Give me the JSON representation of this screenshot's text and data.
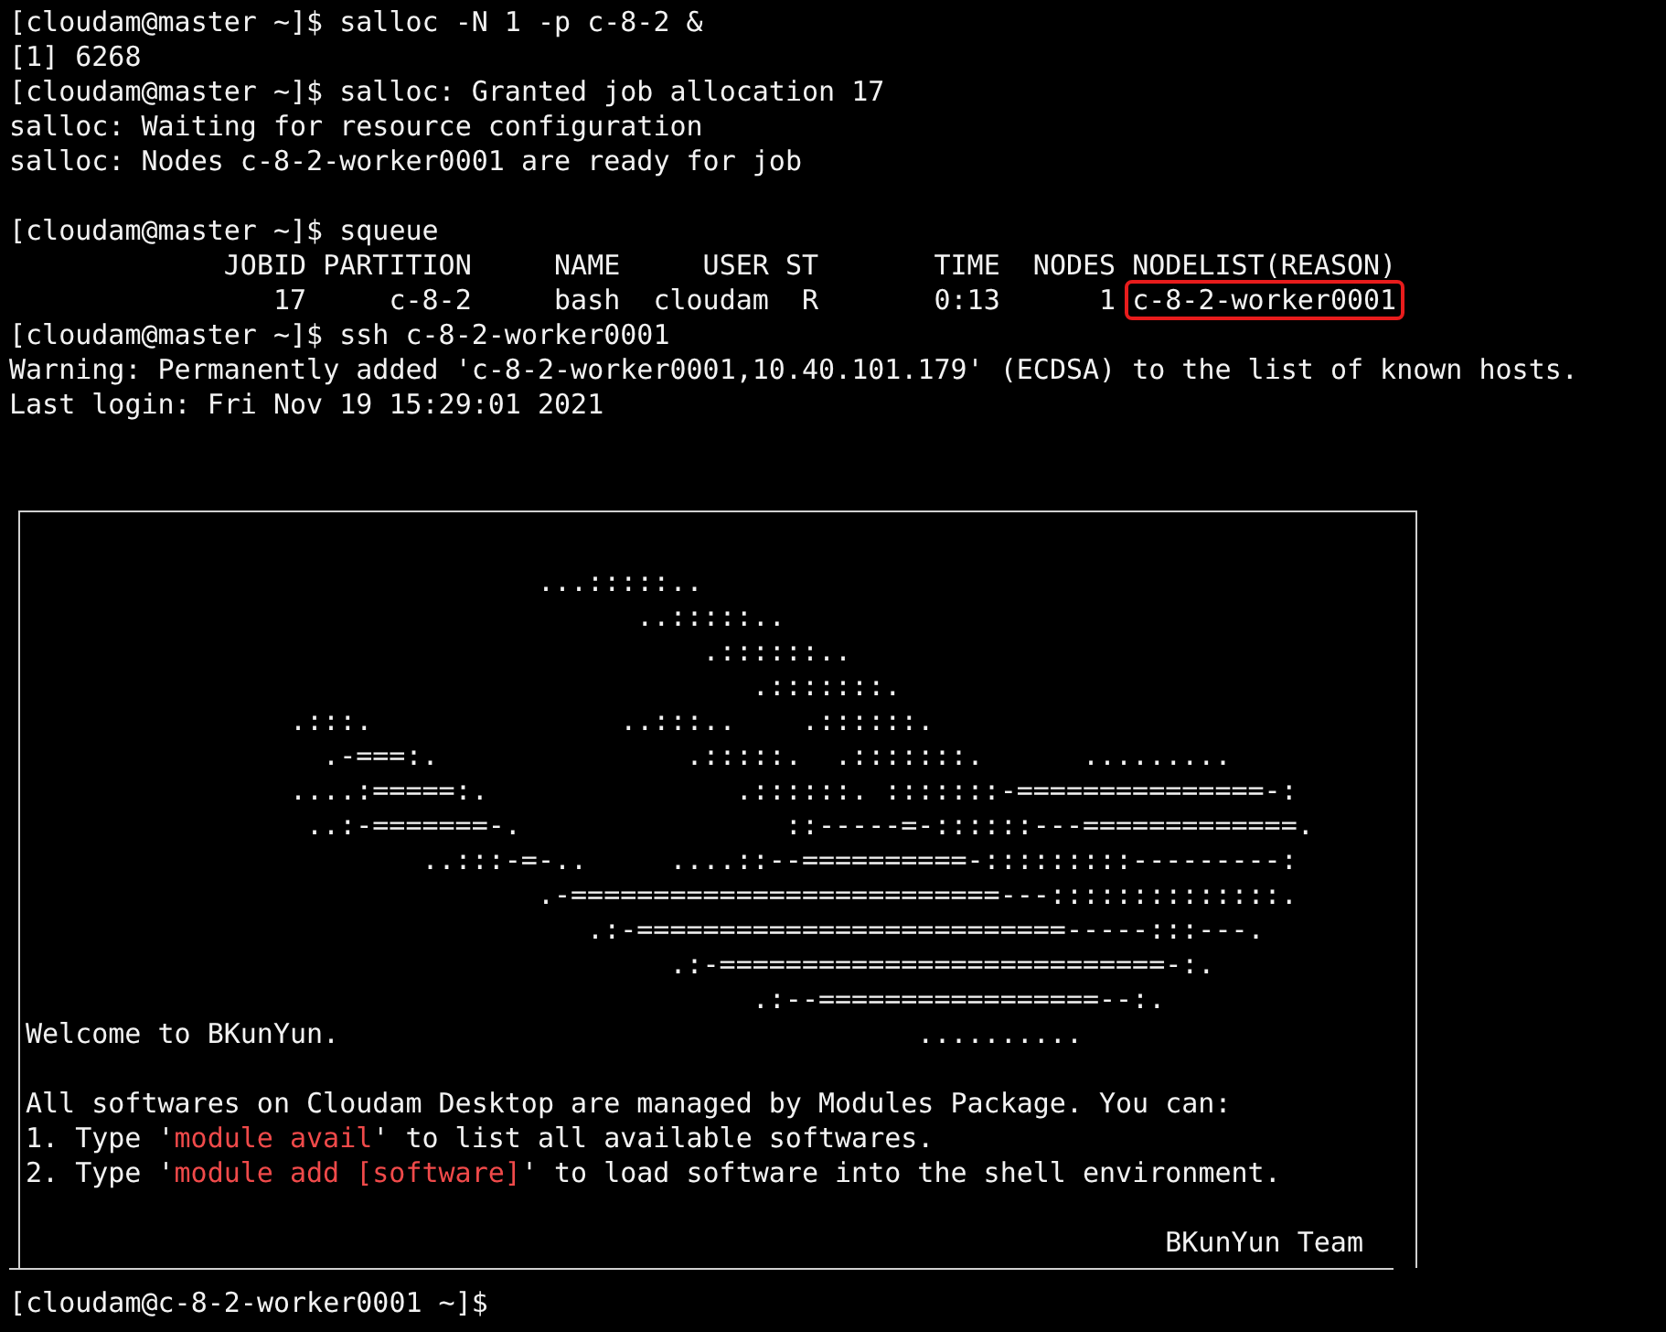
{
  "terminal": {
    "lines": [
      {
        "kind": "text",
        "segments": [
          {
            "kind": "plain",
            "text": "[cloudam@master ~]$ salloc -N 1 -p c-8-2 &"
          }
        ]
      },
      {
        "kind": "text",
        "segments": [
          {
            "kind": "plain",
            "text": "[1] 6268"
          }
        ]
      },
      {
        "kind": "text",
        "segments": [
          {
            "kind": "plain",
            "text": "[cloudam@master ~]$ salloc: Granted job allocation 17"
          }
        ]
      },
      {
        "kind": "text",
        "segments": [
          {
            "kind": "plain",
            "text": "salloc: Waiting for resource configuration"
          }
        ]
      },
      {
        "kind": "text",
        "segments": [
          {
            "kind": "plain",
            "text": "salloc: Nodes c-8-2-worker0001 are ready for job"
          }
        ]
      },
      {
        "kind": "blank"
      },
      {
        "kind": "text",
        "segments": [
          {
            "kind": "plain",
            "text": "[cloudam@master ~]$ squeue"
          }
        ]
      },
      {
        "kind": "text",
        "segments": [
          {
            "kind": "plain",
            "text": "             JOBID PARTITION     NAME     USER ST       TIME  NODES NODELIST(REASON)"
          }
        ]
      },
      {
        "kind": "text",
        "segments": [
          {
            "kind": "plain",
            "text": "                17     c-8-2     bash  cloudam  R       0:13      1 "
          },
          {
            "kind": "highlight",
            "text": "c-8-2-worker0001"
          }
        ]
      },
      {
        "kind": "text",
        "segments": [
          {
            "kind": "plain",
            "text": "[cloudam@master ~]$ ssh c-8-2-worker0001"
          }
        ]
      },
      {
        "kind": "text",
        "segments": [
          {
            "kind": "plain",
            "text": "Warning: Permanently added 'c-8-2-worker0001,10.40.101.179' (ECDSA) to the list of known hosts."
          }
        ]
      },
      {
        "kind": "text",
        "segments": [
          {
            "kind": "plain",
            "text": "Last login: Fri Nov 19 15:29:01 2021"
          }
        ]
      }
    ]
  },
  "motd": {
    "lines": [
      {
        "kind": "art",
        "segments": [
          {
            "kind": "plain",
            "text": "                               ...:::::.."
          }
        ]
      },
      {
        "kind": "art",
        "segments": [
          {
            "kind": "plain",
            "text": "                                     ..:::::.."
          }
        ]
      },
      {
        "kind": "art",
        "segments": [
          {
            "kind": "plain",
            "text": "                                         .::::::.."
          }
        ]
      },
      {
        "kind": "art",
        "segments": [
          {
            "kind": "plain",
            "text": "                                            .:::::::."
          }
        ]
      },
      {
        "kind": "art",
        "segments": [
          {
            "kind": "plain",
            "text": "                .:::.               ..:::..    .::::::."
          }
        ]
      },
      {
        "kind": "art",
        "segments": [
          {
            "kind": "plain",
            "text": "                  .-===:.               .:::::.  .:::::::.      ........."
          }
        ]
      },
      {
        "kind": "art",
        "segments": [
          {
            "kind": "plain",
            "text": "                ....:=====:.               .::::::. :::::::-===============-:"
          }
        ]
      },
      {
        "kind": "art",
        "segments": [
          {
            "kind": "plain",
            "text": "                 ..:-=======-.                ::-----=-::::::---=============."
          }
        ]
      },
      {
        "kind": "art",
        "segments": [
          {
            "kind": "plain",
            "text": "                        ..:::-=-..     ....::--==========-:::::::::---------:"
          }
        ]
      },
      {
        "kind": "art",
        "segments": [
          {
            "kind": "plain",
            "text": "                               .-==========================---::::::::::::::."
          }
        ]
      },
      {
        "kind": "art",
        "segments": [
          {
            "kind": "plain",
            "text": "                                  .:-==========================-----:::---."
          }
        ]
      },
      {
        "kind": "art",
        "segments": [
          {
            "kind": "plain",
            "text": "                                       .:-===========================-:."
          }
        ]
      },
      {
        "kind": "art",
        "segments": [
          {
            "kind": "plain",
            "text": "                                            .:--=================--:."
          }
        ]
      },
      {
        "kind": "text",
        "segments": [
          {
            "kind": "plain",
            "text": "Welcome to BKunYun.                                   .........."
          }
        ]
      },
      {
        "kind": "blank"
      },
      {
        "kind": "text",
        "segments": [
          {
            "kind": "plain",
            "text": "All softwares on Cloudam Desktop are managed by Modules Package. You can:"
          }
        ]
      },
      {
        "kind": "text",
        "segments": [
          {
            "kind": "plain",
            "text": "1. Type '"
          },
          {
            "kind": "command",
            "text": "module avail"
          },
          {
            "kind": "plain",
            "text": "' to list all available softwares."
          }
        ]
      },
      {
        "kind": "text",
        "segments": [
          {
            "kind": "plain",
            "text": "2. Type '"
          },
          {
            "kind": "command",
            "text": "module add [software]"
          },
          {
            "kind": "plain",
            "text": "' to load software into the shell environment."
          }
        ]
      },
      {
        "kind": "blank"
      },
      {
        "kind": "text",
        "segments": [
          {
            "kind": "plain",
            "text": "                                                                     BKunYun Team"
          }
        ]
      }
    ]
  },
  "prompt": "[cloudam@c-8-2-worker0001 ~]$"
}
